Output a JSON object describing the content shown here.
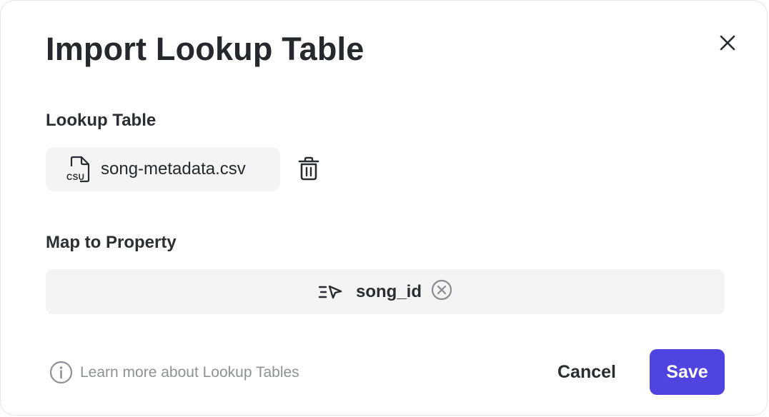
{
  "dialog": {
    "title": "Import Lookup Table",
    "close_icon": "close-icon"
  },
  "lookup_table": {
    "label": "Lookup Table",
    "file_name": "song-metadata.csv",
    "file_icon": "csv-file-icon",
    "delete_icon": "trash-icon"
  },
  "map_to_property": {
    "label": "Map to Property",
    "property_icon": "event-property-icon",
    "value": "song_id",
    "clear_icon": "clear-circle-icon"
  },
  "footer": {
    "learn_more_icon": "info-icon",
    "learn_more_text": "Learn more about Lookup Tables",
    "cancel_label": "Cancel",
    "save_label": "Save"
  },
  "colors": {
    "primary": "#4f44e0",
    "field_background": "#f4f4f5",
    "muted_text": "#8f9196",
    "text": "#26282d"
  }
}
